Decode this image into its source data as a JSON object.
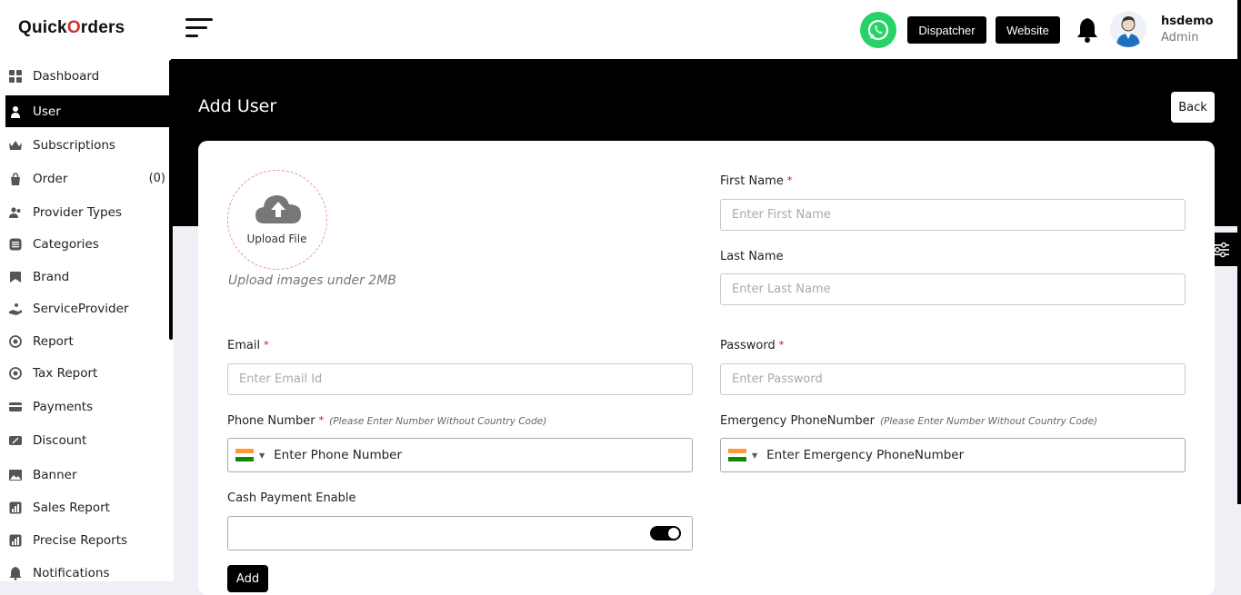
{
  "brand": {
    "logo_prefix": "Quick",
    "logo_o": "O",
    "logo_suffix": "rders"
  },
  "sidebar": {
    "items": [
      {
        "label": "Dashboard",
        "icon": "dashboard-icon"
      },
      {
        "label": "User",
        "icon": "user-icon",
        "active": true
      },
      {
        "label": "Subscriptions",
        "icon": "crown-icon"
      },
      {
        "label": "Order",
        "icon": "bag-icon",
        "count": "(0)"
      },
      {
        "label": "Provider Types",
        "icon": "users-icon"
      },
      {
        "label": "Categories",
        "icon": "list-icon"
      },
      {
        "label": "Brand",
        "icon": "bookmark-icon"
      },
      {
        "label": "ServiceProvider",
        "icon": "hand-icon"
      },
      {
        "label": "Report",
        "icon": "report-icon"
      },
      {
        "label": "Tax Report",
        "icon": "report-icon"
      },
      {
        "label": "Payments",
        "icon": "card-icon"
      },
      {
        "label": "Discount",
        "icon": "discount-icon"
      },
      {
        "label": "Banner",
        "icon": "image-icon"
      },
      {
        "label": "Sales Report",
        "icon": "chart-icon"
      },
      {
        "label": "Precise Reports",
        "icon": "chart-icon"
      },
      {
        "label": "Notifications",
        "icon": "bell-icon"
      }
    ]
  },
  "topbar": {
    "dispatcher_label": "Dispatcher",
    "website_label": "Website",
    "user_name": "hsdemo",
    "user_role": "Admin"
  },
  "page": {
    "title": "Add  User",
    "back_label": "Back"
  },
  "form": {
    "upload_label": "Upload File",
    "upload_hint": "Upload images under 2MB",
    "first_name_label": "First Name",
    "first_name_placeholder": "Enter First Name",
    "last_name_label": "Last Name",
    "last_name_placeholder": "Enter Last Name",
    "email_label": "Email",
    "email_placeholder": "Enter Email Id",
    "password_label": "Password",
    "password_placeholder": "Enter Password",
    "phone_label": "Phone Number",
    "phone_hint": "(Please Enter Number Without Country Code)",
    "phone_placeholder": "Enter Phone Number",
    "emergency_label": "Emergency PhoneNumber",
    "emergency_hint": "(Please Enter Number Without Country Code)",
    "emergency_placeholder": "Enter Emergency PhoneNumber",
    "cash_label": "Cash Payment Enable",
    "cash_enabled": true,
    "required_mark": "*",
    "add_label": "Add"
  },
  "colors": {
    "accent": "#000000",
    "whatsapp": "#25d366",
    "required": "#dd0000"
  }
}
